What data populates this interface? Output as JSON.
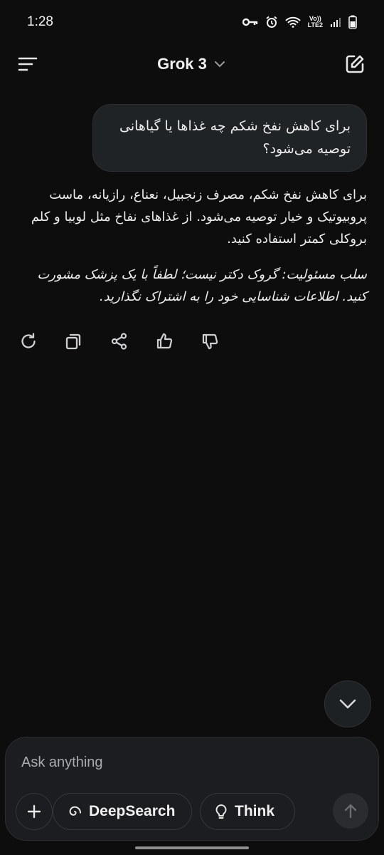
{
  "status": {
    "time": "1:28",
    "network_top": "Vo))",
    "network_bottom": "LTE2"
  },
  "header": {
    "title": "Grok 3"
  },
  "chat": {
    "user_message": "برای کاهش نفخ شکم چه غذاها یا گیاهانی توصیه می‌شود؟",
    "assistant_answer": "برای کاهش نفخ شکم، مصرف زنجبیل، نعناع، رازیانه، ماست پروبیوتیک و خیار توصیه می‌شود. از غذاهای نفاخ مثل لوبیا و کلم بروکلی کمتر استفاده کنید.",
    "assistant_disclaimer": "سلب مسئولیت: گروک دکتر نیست؛ لطفاً با یک پزشک مشورت کنید. اطلاعات شناسایی خود را به اشتراک نگذارید."
  },
  "composer": {
    "placeholder": "Ask anything",
    "value": "",
    "deepsearch_label": "DeepSearch",
    "think_label": "Think"
  },
  "colors": {
    "background": "#0d0d0d",
    "bubble": "#1f2326",
    "composer": "#1b1d20",
    "text": "#ededed",
    "muted": "#a9abae"
  }
}
